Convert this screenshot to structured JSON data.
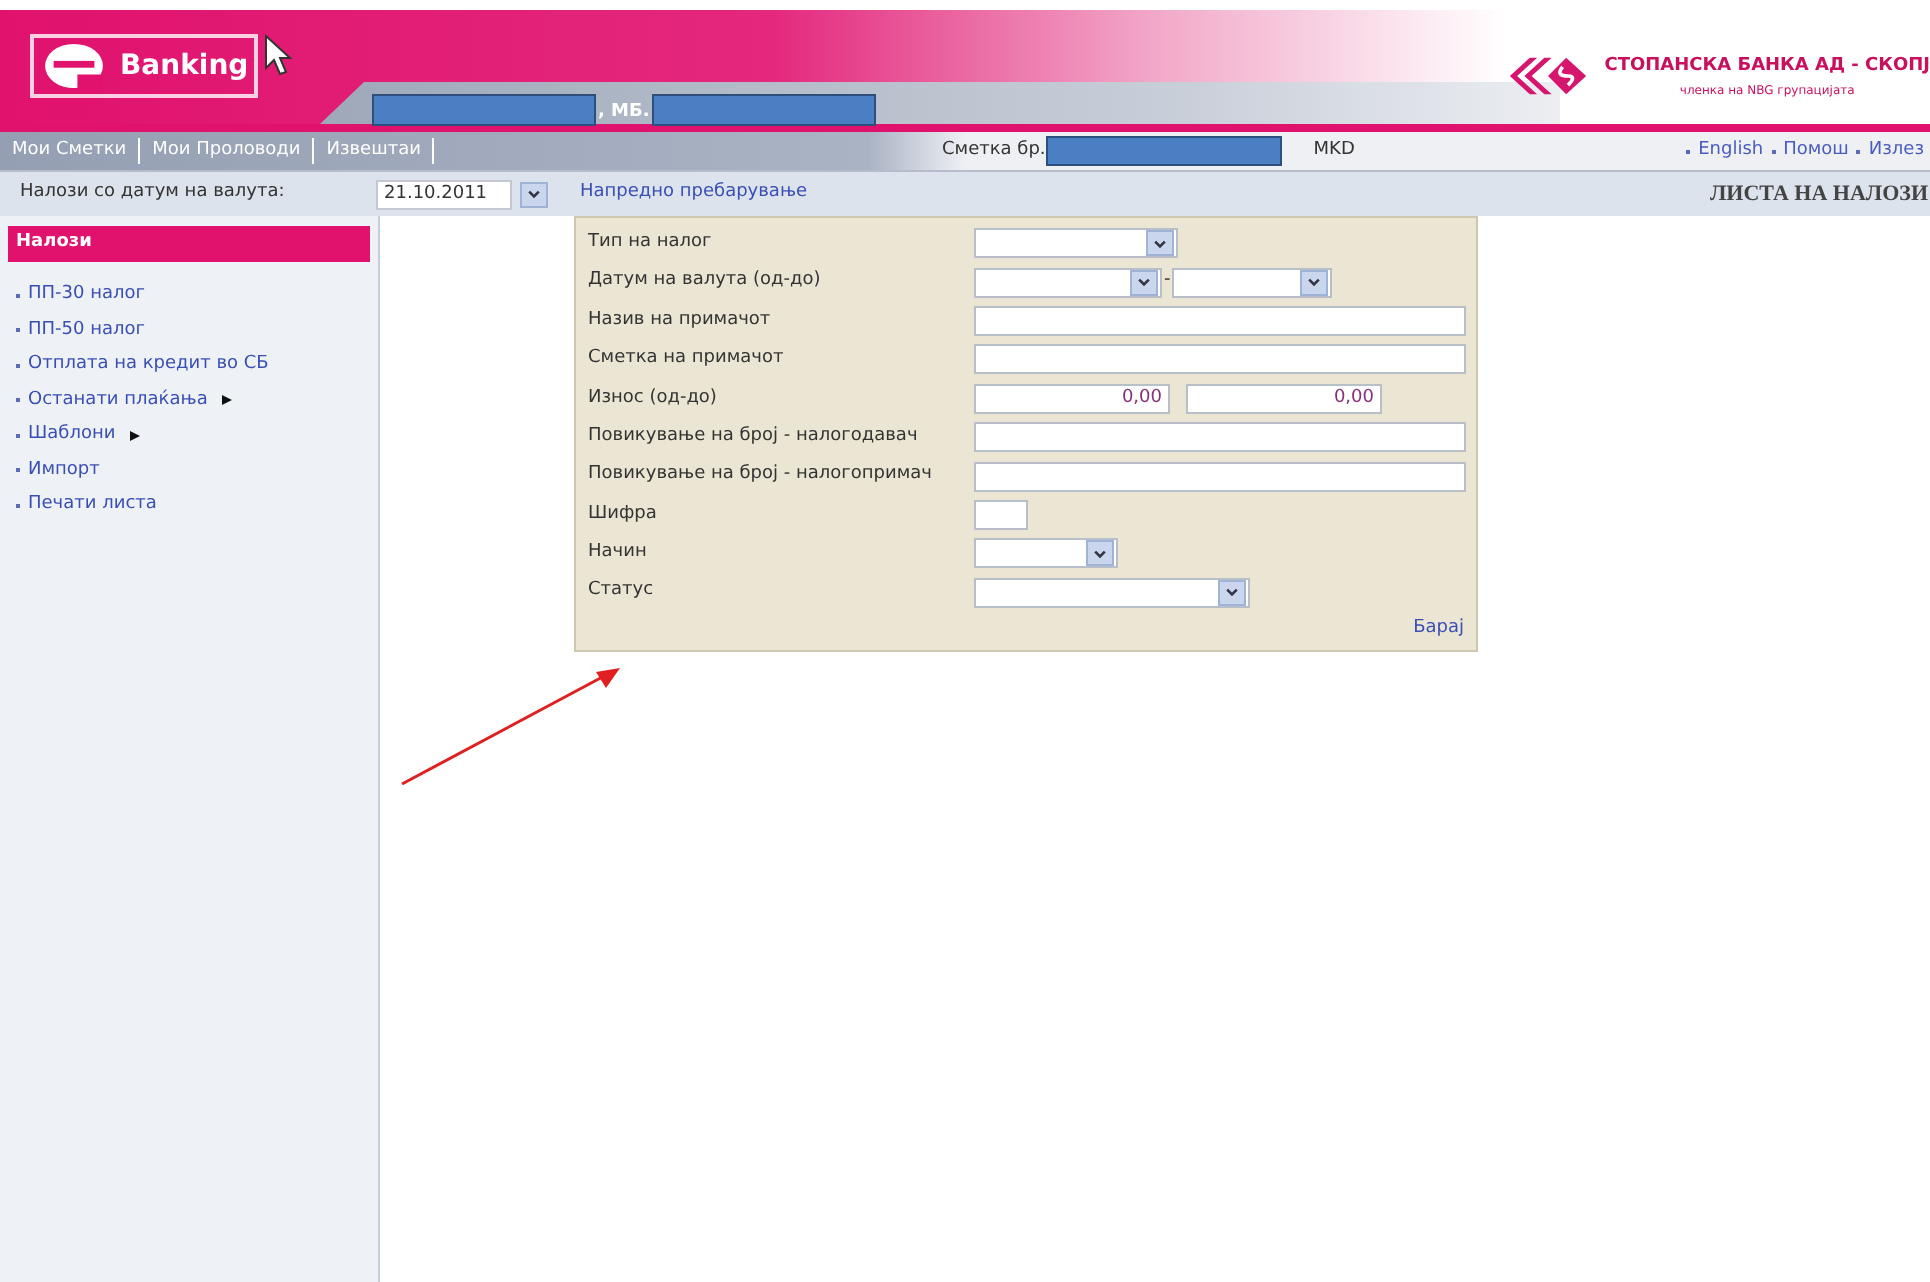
{
  "header": {
    "logo_text": "Banking",
    "user_separator": ", МБ.",
    "bank_name": "СТОПАНСКА БАНКА АД - СКОПЈ",
    "bank_subtitle": "членка на NBG групацијата"
  },
  "nav": {
    "tabs": [
      {
        "label": "Мои Сметки"
      },
      {
        "label": "Мои Проловоди"
      },
      {
        "label": "Извештаи"
      }
    ],
    "account_label": "Сметка бр.",
    "currency": "MKD",
    "links": [
      "English",
      "Помош",
      "Излез"
    ]
  },
  "filter": {
    "label": "Налози со датум на валута:",
    "date": "21.10.2011",
    "advanced_link": "Напредно пребарување",
    "page_title": "ЛИСТА НА НАЛОЗИ"
  },
  "sidebar": {
    "title": "Налози",
    "items": [
      {
        "label": "ПП-30 налог",
        "submenu": false
      },
      {
        "label": "ПП-50 налог",
        "submenu": false
      },
      {
        "label": "Отплата на кредит во СБ",
        "submenu": false
      },
      {
        "label": "Останати плаќања",
        "submenu": true
      },
      {
        "label": "Шаблони",
        "submenu": true
      },
      {
        "label": "Импорт",
        "submenu": false
      },
      {
        "label": "Печати листа",
        "submenu": false
      }
    ]
  },
  "search_form": {
    "fields": [
      {
        "label": "Тип на налог",
        "kind": "select"
      },
      {
        "label": "Датум на валута (од-до)",
        "kind": "date_range",
        "separator": "-"
      },
      {
        "label": "Назив на примачот",
        "kind": "text"
      },
      {
        "label": "Сметка на примачот",
        "kind": "text"
      },
      {
        "label": "Износ (од-до)",
        "kind": "amount_range",
        "from": "0,00",
        "to": "0,00"
      },
      {
        "label": "Повикување на број - налогодавач",
        "kind": "text"
      },
      {
        "label": "Повикување на број - налогопримач",
        "kind": "text"
      },
      {
        "label": "Шифра",
        "kind": "short"
      },
      {
        "label": "Начин",
        "kind": "select_small"
      },
      {
        "label": "Статус",
        "kind": "select_medium"
      }
    ],
    "search_button": "Барај"
  }
}
